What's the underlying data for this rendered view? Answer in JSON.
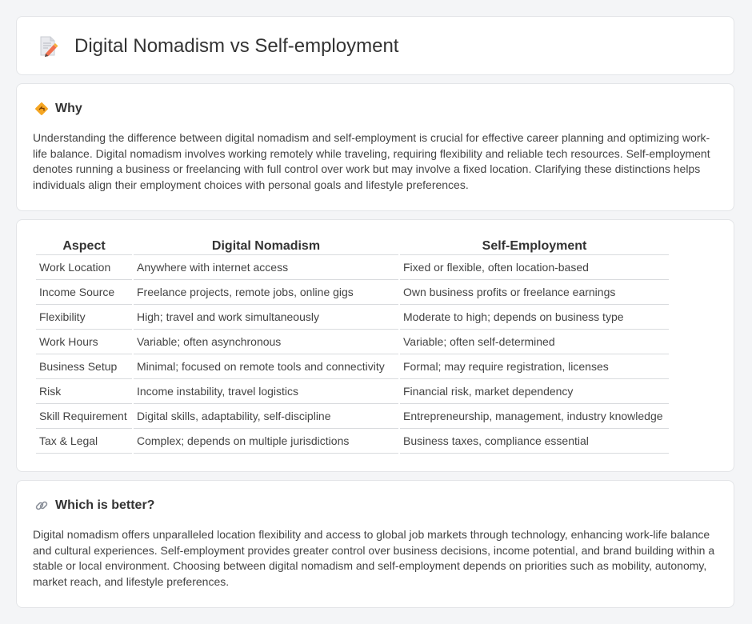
{
  "header": {
    "title": "Digital Nomadism vs Self-employment",
    "icon": "document-pencil-icon"
  },
  "why": {
    "icon": "diamond-sign-icon",
    "title": "Why",
    "body": "Understanding the difference between digital nomadism and self-employment is crucial for effective career planning and optimizing work-life balance. Digital nomadism involves working remotely while traveling, requiring flexibility and reliable tech resources. Self-employment denotes running a business or freelancing with full control over work but may involve a fixed location. Clarifying these distinctions helps individuals align their employment choices with personal goals and lifestyle preferences."
  },
  "table": {
    "headers": [
      "Aspect",
      "Digital Nomadism",
      "Self-Employment"
    ],
    "rows": [
      [
        "Work Location",
        "Anywhere with internet access",
        "Fixed or flexible, often location-based"
      ],
      [
        "Income Source",
        "Freelance projects, remote jobs, online gigs",
        "Own business profits or freelance earnings"
      ],
      [
        "Flexibility",
        "High; travel and work simultaneously",
        "Moderate to high; depends on business type"
      ],
      [
        "Work Hours",
        "Variable; often asynchronous",
        "Variable; often self-determined"
      ],
      [
        "Business Setup",
        "Minimal; focused on remote tools and connectivity",
        "Formal; may require registration, licenses"
      ],
      [
        "Risk",
        "Income instability, travel logistics",
        "Financial risk, market dependency"
      ],
      [
        "Skill Requirement",
        "Digital skills, adaptability, self-discipline",
        "Entrepreneurship, management, industry knowledge"
      ],
      [
        "Tax & Legal",
        "Complex; depends on multiple jurisdictions",
        "Business taxes, compliance essential"
      ]
    ]
  },
  "better": {
    "icon": "link-icon",
    "title": "Which is better?",
    "body": "Digital nomadism offers unparalleled location flexibility and access to global job markets through technology, enhancing work-life balance and cultural experiences. Self-employment provides greater control over business decisions, income potential, and brand building within a stable or local environment. Choosing between digital nomadism and self-employment depends on priorities such as mobility, autonomy, market reach, and lifestyle preferences."
  }
}
